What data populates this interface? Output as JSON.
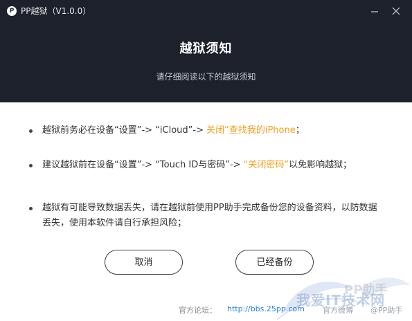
{
  "titlebar": {
    "logo_letter": "P",
    "app_title": "PP越狱（V1.0.0）"
  },
  "header": {
    "heading": "越狱须知",
    "subheading": "请仔细阅读以下的越狱须知"
  },
  "notices": [
    {
      "plain": "越狱前务必在设备“设置”-> “iCloud”-> ",
      "highlight": "关闭“查找我的iPhone",
      "suffix": "；"
    },
    {
      "plain": "建议越狱前在设备“设置”-> “Touch ID与密码”-> ",
      "highlight": "“关闭密码”",
      "suffix": "以免影响越狱；"
    },
    {
      "plain": "越狱有可能导致数据丢失，请在越狱前使用PP助手完成备份您的设备资料，以防数据丢失，使用本软件请自行承担风险；"
    }
  ],
  "buttons": {
    "cancel": "取消",
    "backed_up": "已经备份"
  },
  "footer": {
    "forum_label": "官方论坛：",
    "forum_url": "http://bbs.25pp.com",
    "official_weibo": "官方微博",
    "pp_helper": "@PP助手"
  },
  "watermark": {
    "text": "我爱IT技术网",
    "pp_text": "PP助手"
  },
  "colors": {
    "header_bg": "#1c212b",
    "highlight": "#f0a020",
    "link": "#2a7fd4"
  }
}
